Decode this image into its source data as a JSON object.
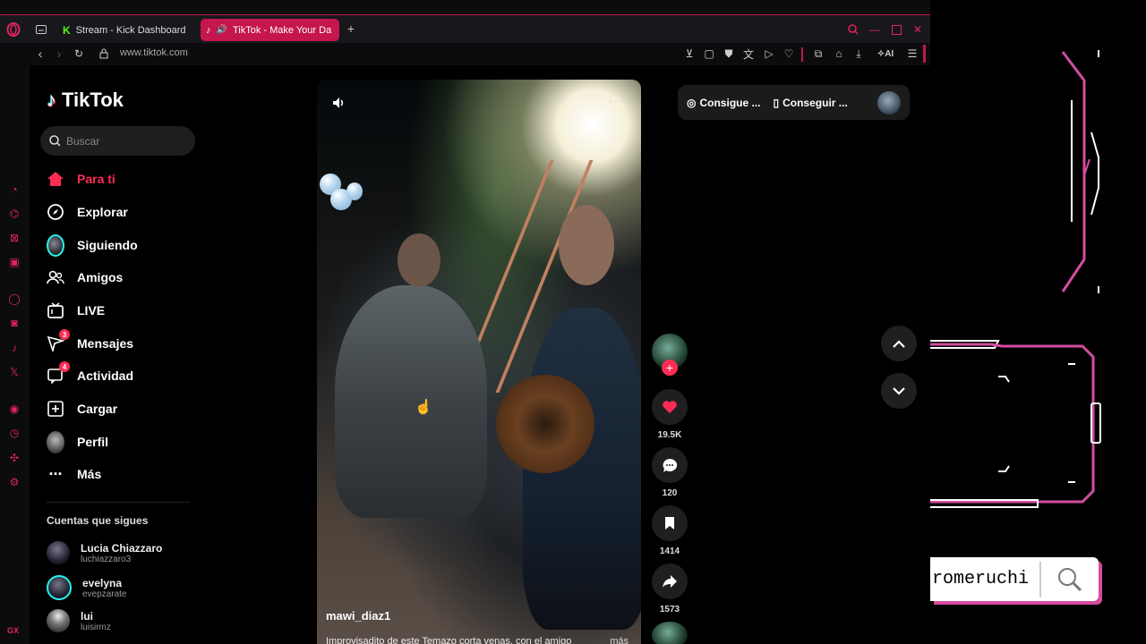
{
  "browser": {
    "tabs": [
      {
        "label": "Stream - Kick Dashboard",
        "favicon": "kick-icon",
        "color": "#53fc18"
      },
      {
        "label": "TikTok - Make Your Da",
        "favicon": "tiktok-icon"
      }
    ],
    "url": "www.tiktok.com",
    "accent": "#c5164d",
    "ai_label": "AI",
    "gx_label": "GX"
  },
  "sidebar": {
    "logo": "TikTok",
    "search_placeholder": "Buscar",
    "nav": [
      {
        "label": "Para ti",
        "icon": "home-icon",
        "active": true
      },
      {
        "label": "Explorar",
        "icon": "compass-icon"
      },
      {
        "label": "Siguiendo",
        "icon": "following-avatar"
      },
      {
        "label": "Amigos",
        "icon": "friends-icon"
      },
      {
        "label": "LIVE",
        "icon": "live-icon"
      },
      {
        "label": "Mensajes",
        "icon": "messages-icon",
        "badge": "3"
      },
      {
        "label": "Actividad",
        "icon": "activity-icon",
        "badge": "4"
      },
      {
        "label": "Cargar",
        "icon": "upload-icon"
      },
      {
        "label": "Perfil",
        "icon": "profile-avatar"
      },
      {
        "label": "Más",
        "icon": "more-icon"
      }
    ],
    "following_title": "Cuentas que sigues",
    "accounts": [
      {
        "name": "Lucia Chiazzaro",
        "handle": "luchiazzaro3"
      },
      {
        "name": "evelyna",
        "handle": "evepzarate"
      },
      {
        "name": "lui",
        "handle": "luisirmz"
      }
    ]
  },
  "video": {
    "author": "mawi_diaz1",
    "caption": "Improvisadito de este Temazo corta venas, con el amigo",
    "more": "más"
  },
  "actions": {
    "likes": "19.5K",
    "comments": "120",
    "saves": "1414",
    "shares": "1573"
  },
  "topbar": {
    "coins": "Consigue ...",
    "app": "Conseguir ..."
  },
  "overlay": {
    "search_text": "romeruchi",
    "accent": "#d44ca0"
  }
}
